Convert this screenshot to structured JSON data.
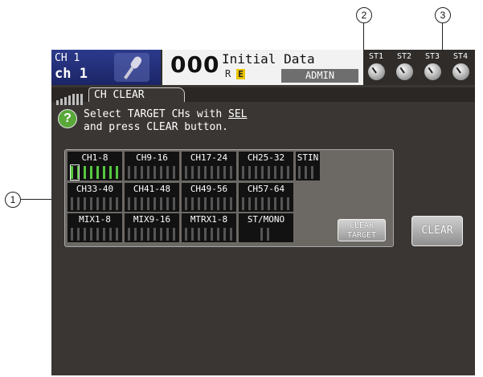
{
  "callouts": {
    "c1": "1",
    "c2": "2",
    "c3": "3"
  },
  "header": {
    "channel_number": "CH 1",
    "channel_name": "ch 1",
    "scene_number": "000",
    "scene_title": "Initial Data",
    "scene_flag_r": "R",
    "scene_flag_e": "E",
    "user": "ADMIN",
    "stereo_labels": [
      "ST1",
      "ST2",
      "ST3",
      "ST4"
    ]
  },
  "tab": {
    "label": "CH CLEAR"
  },
  "help": {
    "line1_prefix": "Select TARGET CHs with ",
    "line1_link": "SEL",
    "line2": "and press CLEAR button."
  },
  "groups": {
    "row1": [
      "CH1-8",
      "CH9-16",
      "CH17-24",
      "CH25-32",
      "STIN"
    ],
    "row2": [
      "CH33-40",
      "CH41-48",
      "CH49-56",
      "CH57-64"
    ],
    "row3": [
      "MIX1-8",
      "MIX9-16",
      "MTRX1-8",
      "ST/MONO"
    ]
  },
  "buttons": {
    "clear_target_line1": "CLEAR",
    "clear_target_line2": "TARGET",
    "clear": "CLEAR"
  },
  "colors": {
    "channel_box": "#1b2566",
    "active_fader": "#55c83e",
    "help_icon": "#58a83a",
    "scene_e_flag": "#e9c400"
  },
  "icons": {
    "channel": "microphone-icon",
    "help": "question-icon",
    "knob": "rotary-knob-icon"
  },
  "state": {
    "selected_group": "CH1-8"
  }
}
